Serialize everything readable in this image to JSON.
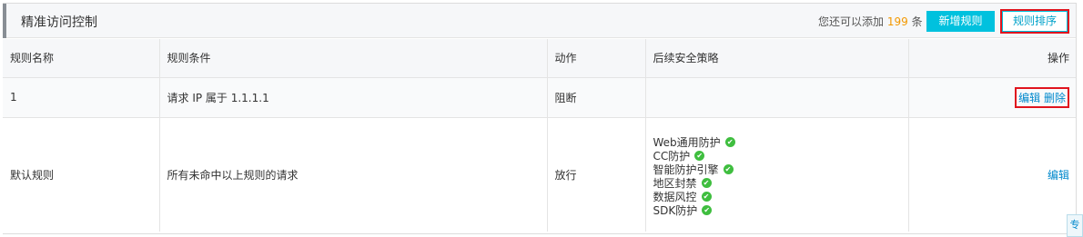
{
  "header": {
    "title": "精准访问控制",
    "quota_prefix": "您还可以添加",
    "quota_count": "199",
    "quota_suffix": "条",
    "new_rule_label": "新增规则",
    "sort_rule_label": "规则排序"
  },
  "table": {
    "columns": [
      "规则名称",
      "规则条件",
      "动作",
      "后续安全策略",
      "操作"
    ],
    "rows": [
      {
        "name": "1",
        "condition": "请求 IP 属于 1.1.1.1",
        "action": "阻断",
        "edit_label": "编辑",
        "delete_label": "删除"
      },
      {
        "name": "默认规则",
        "condition": "所有未命中以上规则的请求",
        "action": "放行",
        "strategies": [
          "Web通用防护",
          "CC防护",
          "智能防护引擎",
          "地区封禁",
          "数据风控",
          "SDK防护"
        ],
        "edit_label": "编辑"
      }
    ]
  },
  "corner_tab": "专",
  "colors": {
    "accent": "#00c1de",
    "highlight_border": "#e0141e",
    "count": "#f39800",
    "check": "#3fbe3f",
    "link": "#0088cc"
  }
}
